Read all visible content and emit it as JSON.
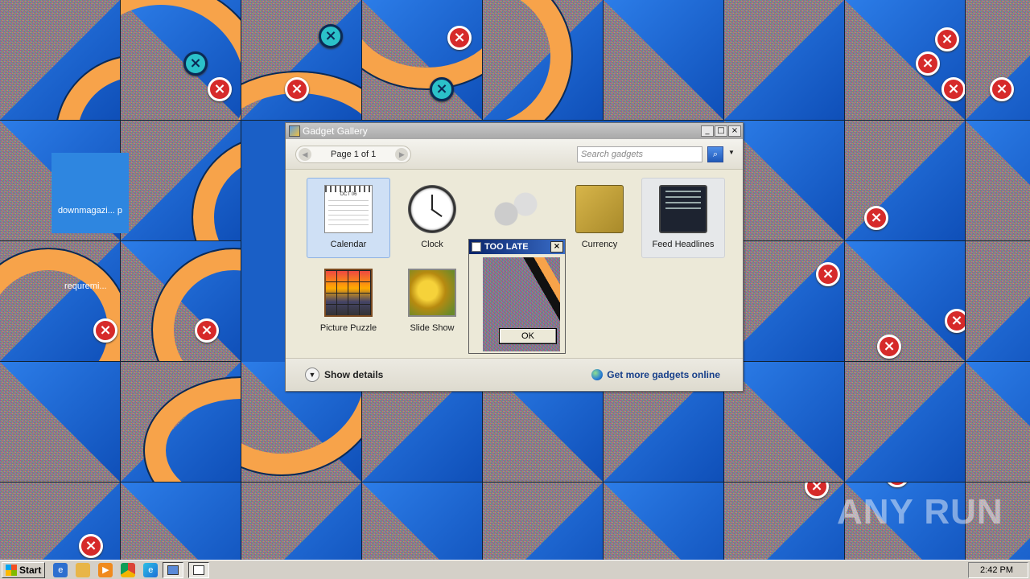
{
  "desktop": {
    "icons": [
      {
        "label": "downmagazi... p"
      },
      {
        "label": "requremi..."
      }
    ]
  },
  "gallery": {
    "title": "Gadget Gallery",
    "page_label": "Page 1 of 1",
    "search_placeholder": "Search gadgets",
    "gadgets": [
      {
        "name": "Calendar",
        "icon": "calendar-icon",
        "month_label": "OCT 06"
      },
      {
        "name": "Clock",
        "icon": "clock-icon"
      },
      {
        "name": "",
        "icon": "cpu-meter-icon"
      },
      {
        "name": "Currency",
        "icon": "currency-icon"
      },
      {
        "name": "Feed Headlines",
        "icon": "feed-headlines-icon"
      },
      {
        "name": "Picture Puzzle",
        "icon": "picture-puzzle-icon"
      },
      {
        "name": "Slide Show",
        "icon": "slide-show-icon"
      }
    ],
    "show_details": "Show details",
    "more_gadgets": "Get more gadgets online"
  },
  "dialog": {
    "title": "TOO LATE",
    "ok_label": "OK"
  },
  "taskbar": {
    "start_label": "Start",
    "clock": "2:42 PM"
  },
  "watermark": "ANY RUN"
}
